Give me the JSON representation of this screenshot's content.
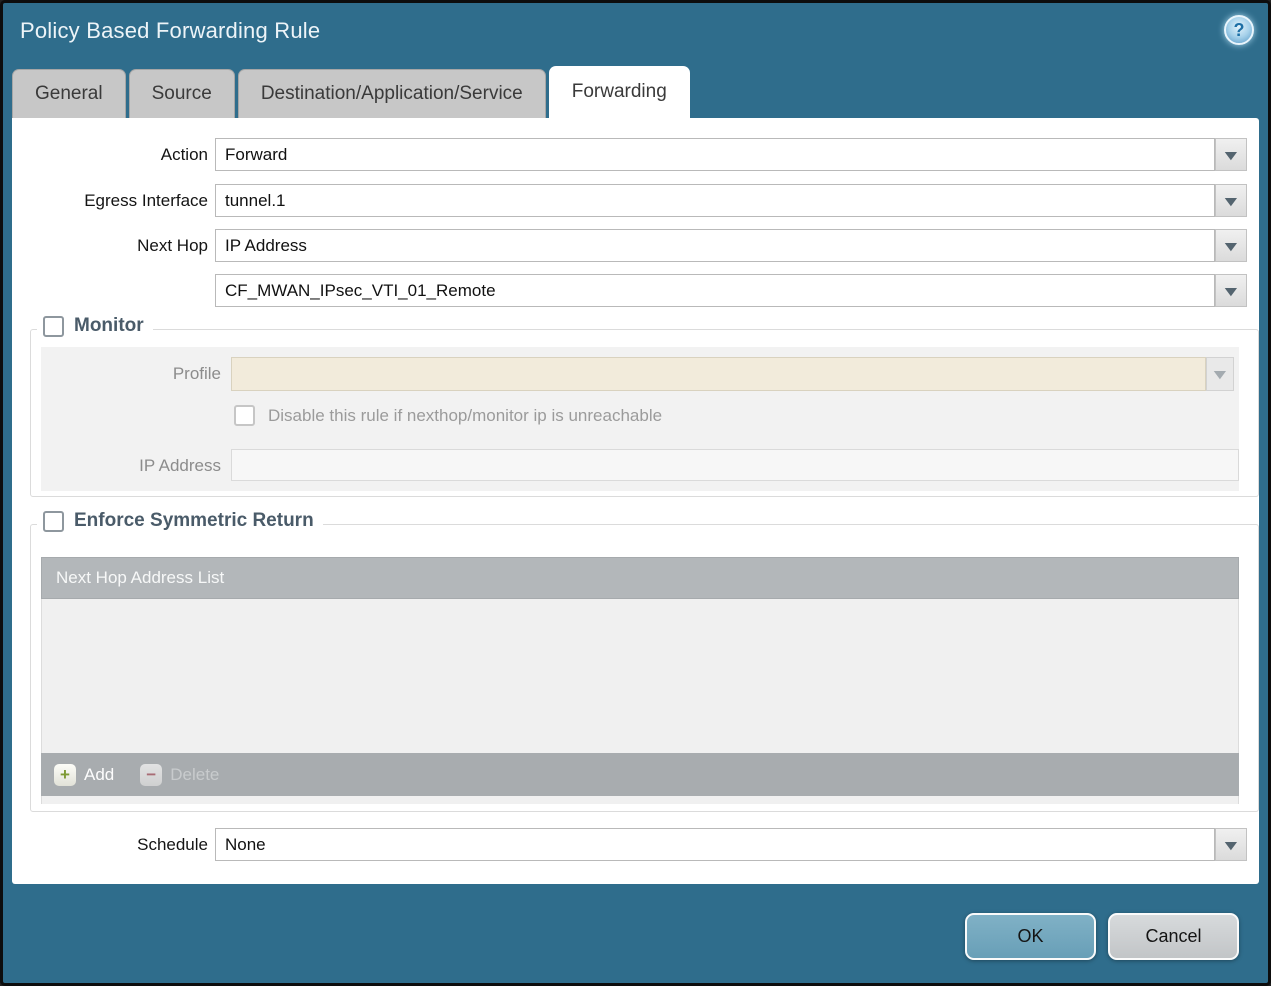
{
  "window": {
    "title": "Policy Based Forwarding Rule"
  },
  "icons": {
    "help": "?",
    "dropdown": "▼",
    "add": "+",
    "delete": "−"
  },
  "tabs": [
    {
      "label": "General",
      "active": false
    },
    {
      "label": "Source",
      "active": false
    },
    {
      "label": "Destination/Application/Service",
      "active": false
    },
    {
      "label": "Forwarding",
      "active": true
    }
  ],
  "form": {
    "action_label": "Action",
    "action_value": "Forward",
    "egress_label": "Egress Interface",
    "egress_value": "tunnel.1",
    "next_hop_label": "Next Hop",
    "next_hop_value": "IP Address",
    "next_hop_address_value": "CF_MWAN_IPsec_VTI_01_Remote",
    "schedule_label": "Schedule",
    "schedule_value": "None"
  },
  "monitor": {
    "legend": "Monitor",
    "checked": false,
    "profile_label": "Profile",
    "profile_value": "",
    "disable_label": "Disable this rule if nexthop/monitor ip is unreachable",
    "disable_checked": false,
    "ip_label": "IP Address",
    "ip_value": ""
  },
  "symmetric": {
    "legend": "Enforce Symmetric Return",
    "checked": false,
    "table_header": "Next Hop Address List",
    "rows": [],
    "add_label": "Add",
    "delete_label": "Delete",
    "delete_enabled": false
  },
  "buttons": {
    "ok": "OK",
    "cancel": "Cancel"
  },
  "colors": {
    "titlebar": "#2F6D8C",
    "tab_inactive": "#C7C7C7",
    "tab_active": "#FFFFFF",
    "disabled_field_bg": "#F2EBDB",
    "panel_bg": "#F2F2F2",
    "table_header_bg": "#B3B7BA",
    "toolbar_bg": "#A8ACAF",
    "ok_button_bg": "#6FA2BA",
    "cancel_button_bg": "#C9CCCE",
    "legend_text": "#4A5B69",
    "add_plus": "#7E9A33",
    "delete_minus": "#A8616B"
  }
}
